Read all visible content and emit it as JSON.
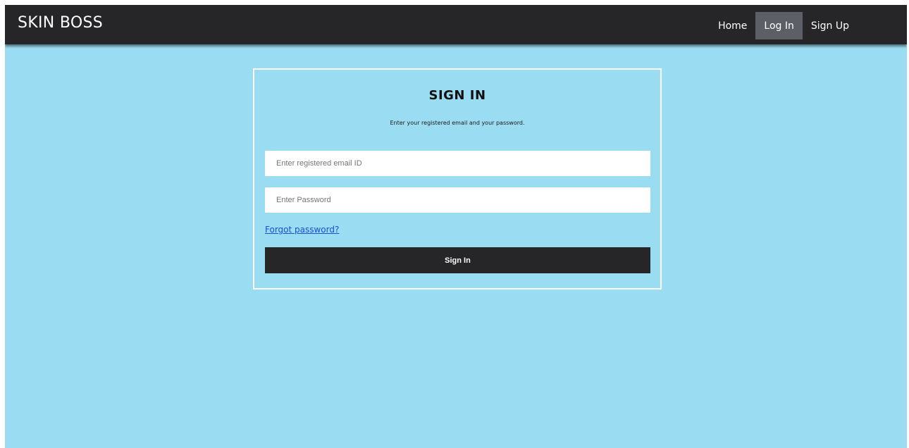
{
  "brand": {
    "name": "SKIN BOSS"
  },
  "nav": {
    "items": [
      {
        "label": "Home",
        "active": false
      },
      {
        "label": "Log In",
        "active": true
      },
      {
        "label": "Sign Up",
        "active": false
      }
    ]
  },
  "signin": {
    "title": "SIGN IN",
    "subtitle": "Enter your registered email and your password.",
    "email": {
      "placeholder": "Enter registered email ID",
      "value": ""
    },
    "password": {
      "placeholder": "Enter Password",
      "value": ""
    },
    "forgot_label": "Forgot password?",
    "submit_label": "Sign In"
  },
  "colors": {
    "background": "#9adcf1",
    "navbar": "#262528",
    "nav_active": "#5d5f66",
    "button": "#262528",
    "link": "#1a4fd6"
  }
}
